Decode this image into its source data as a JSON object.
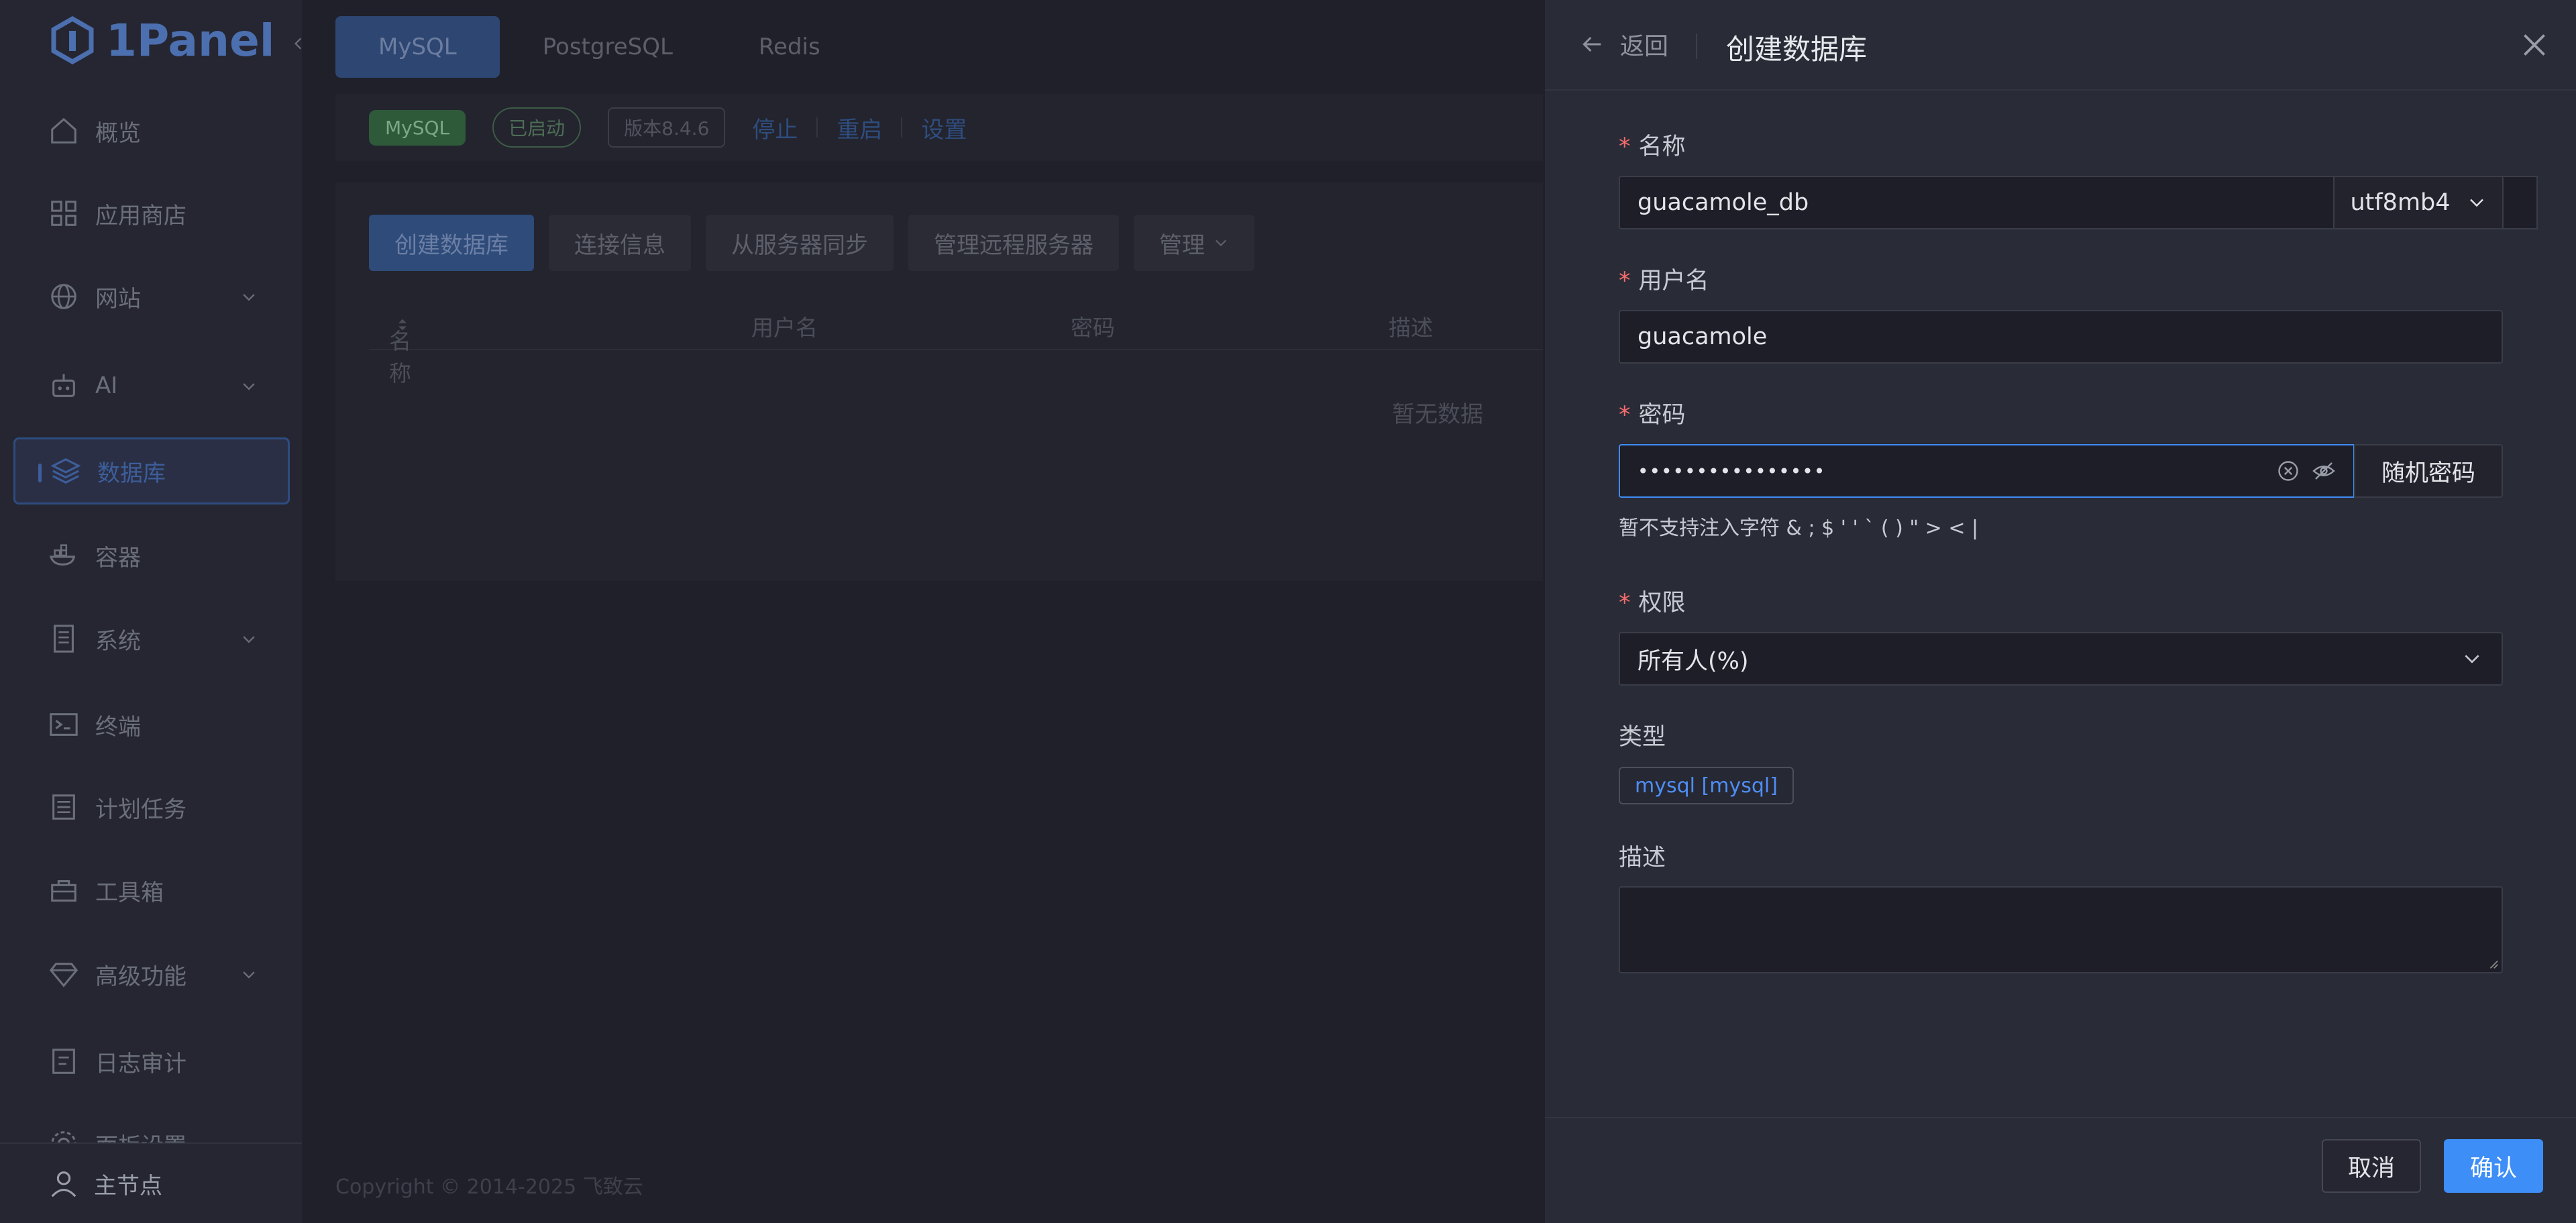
{
  "brand": {
    "logo_text": "1Panel"
  },
  "sidebar": {
    "items": [
      {
        "label": "概览",
        "icon": "home-icon"
      },
      {
        "label": "应用商店",
        "icon": "apps-icon"
      },
      {
        "label": "网站",
        "icon": "globe-icon",
        "expandable": true
      },
      {
        "label": "AI",
        "icon": "robot-icon",
        "expandable": true
      },
      {
        "label": "数据库",
        "icon": "layers-icon",
        "active": true
      },
      {
        "label": "容器",
        "icon": "container-icon"
      },
      {
        "label": "系统",
        "icon": "server-icon",
        "expandable": true
      },
      {
        "label": "终端",
        "icon": "terminal-icon"
      },
      {
        "label": "计划任务",
        "icon": "list-icon"
      },
      {
        "label": "工具箱",
        "icon": "toolbox-icon"
      },
      {
        "label": "高级功能",
        "icon": "diamond-icon",
        "expandable": true
      },
      {
        "label": "日志审计",
        "icon": "log-icon"
      },
      {
        "label": "面板设置",
        "icon": "settings-icon"
      }
    ],
    "bottom": {
      "label": "主节点",
      "icon": "user-icon"
    }
  },
  "db_tabs": [
    "MySQL",
    "PostgreSQL",
    "Redis"
  ],
  "status": {
    "app_badge": "MySQL",
    "state": "已启动",
    "version": "版本8.4.6",
    "actions": [
      "停止",
      "重启",
      "设置"
    ]
  },
  "toolbar": {
    "buttons": [
      "创建数据库",
      "连接信息",
      "从服务器同步",
      "管理远程服务器",
      "管理"
    ]
  },
  "table": {
    "headers": [
      "名称",
      "用户名",
      "密码",
      "描述"
    ],
    "empty_text": "暂无数据"
  },
  "footer": {
    "copyright": "Copyright © 2014-2025 飞致云"
  },
  "drawer": {
    "back_label": "返回",
    "title": "创建数据库",
    "fields": {
      "name": {
        "label": "名称",
        "value": "guacamole_db",
        "charset": "utf8mb4"
      },
      "username": {
        "label": "用户名",
        "value": "guacamole"
      },
      "password": {
        "label": "密码",
        "value": "••••••••••••••••",
        "random_button": "随机密码",
        "hint": "暂不支持注入字符 & ; $ ' ' ` ( ) \" > < |"
      },
      "permission": {
        "label": "权限",
        "value": "所有人(%)"
      },
      "type": {
        "label": "类型",
        "value": "mysql [mysql]"
      },
      "description": {
        "label": "描述",
        "value": ""
      }
    },
    "cancel_label": "取消",
    "confirm_label": "确认"
  },
  "colors": {
    "accent": "#3d8ef6",
    "required": "#f56c6c",
    "drawer_bg": "#292b36",
    "page_bg": "#1f2029"
  }
}
